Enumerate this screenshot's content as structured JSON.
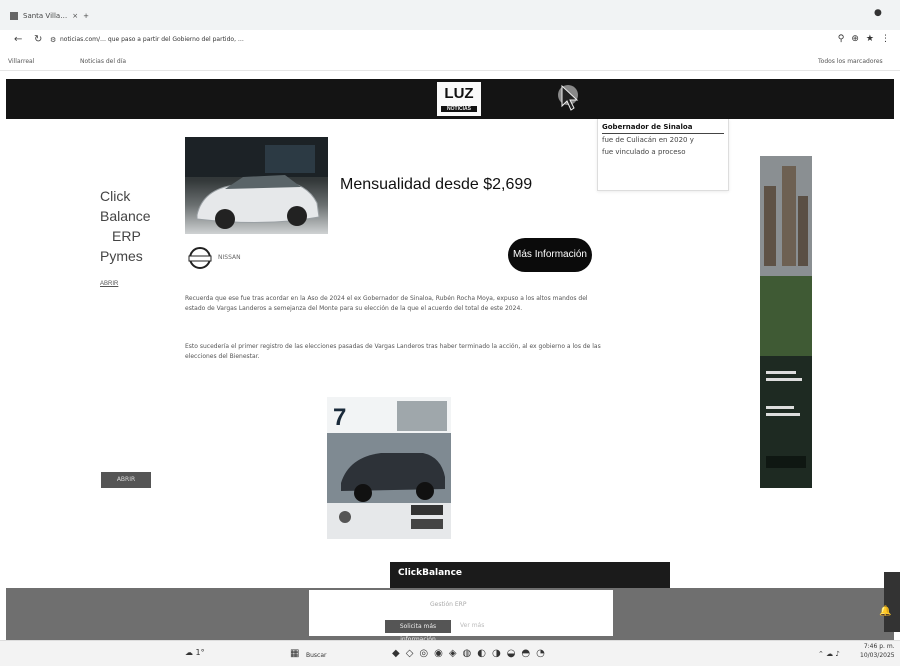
{
  "browser": {
    "tab_title": "Santa Villa…",
    "url": "noticias.com/… que paso a partir del Gobierno del partido, …",
    "bookmarks": [
      "Villarreal",
      "Noticias del día"
    ],
    "right_bookmark": "Todos los marcadores"
  },
  "site": {
    "logo_text": "LUZ",
    "logo_sub": "NOTICIAS"
  },
  "left_ad": {
    "lines": [
      "Click",
      "Balance",
      "ERP",
      "Pymes"
    ],
    "link": "ABRIR",
    "button": "ABRIR"
  },
  "dropdown_box": {
    "lines": [
      "Gobernador de Sinaloa",
      "fue de Culiacán en 2020 y",
      "fue vinculado a proceso"
    ]
  },
  "promo": {
    "title": "Mensualidad desde $2,699",
    "brand": "NISSAN",
    "cta": "Más Información"
  },
  "article": {
    "p1": "Recuerda que ese fue tras acordar en la Aso de 2024 el ex Gobernador de Sinaloa, Rubén Rocha Moya, expuso a los altos mandos del estado de Vargas Landeros a semejanza del Monte para su elección de la que el acuerdo del total de este 2024.",
    "p2": "Esto sucedería el primer registro de las elecciones pasadas de Vargas Landeros tras haber terminado la acción, al ex gobierno a los de las elecciones del Bienestar."
  },
  "bottom_popup": {
    "brand": "ClickBalance",
    "text": "Gestión ERP",
    "button": "Solicita más información",
    "link": "Ver más"
  },
  "taskbar": {
    "search": "Buscar",
    "time": "7:46 p. m.",
    "date": "10/03/2025"
  }
}
